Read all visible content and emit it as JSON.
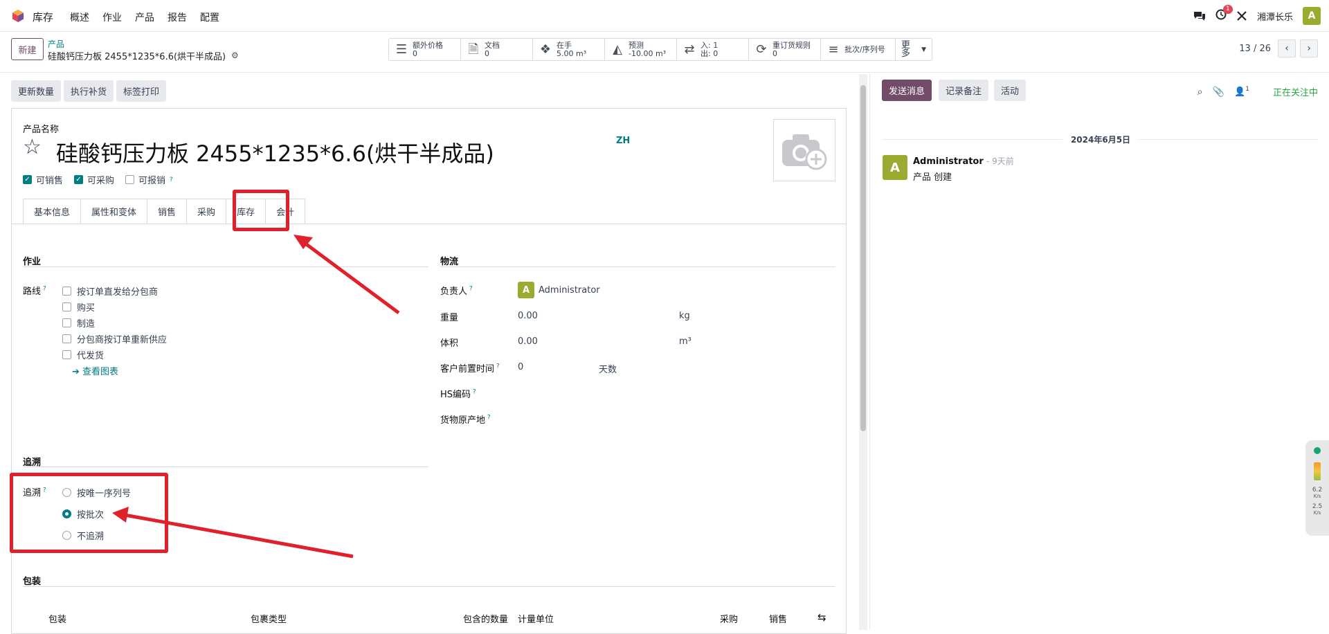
{
  "navbar": {
    "app_name": "库存",
    "menu": [
      "概述",
      "作业",
      "产品",
      "报告",
      "配置"
    ],
    "activity_count": "1",
    "company": "湘潭长乐",
    "user_initial": "A"
  },
  "control_panel": {
    "new_button": "新建",
    "breadcrumb_parent": "产品",
    "breadcrumb_current": "硅酸钙压力板 2455*1235*6.6(烘干半成品)",
    "smart_buttons": [
      {
        "icon": "list-icon",
        "label": "额外价格",
        "value": "0"
      },
      {
        "icon": "document-icon",
        "label": "文档",
        "value": "0"
      },
      {
        "icon": "cubes-icon",
        "label": "在手",
        "value": "5.00 m³"
      },
      {
        "icon": "area-chart-icon",
        "label": "预测",
        "value": "-10.00 m³"
      },
      {
        "icon": "exchange-icon",
        "label": "入:",
        "value": "1",
        "label2": "出:",
        "value2": "0"
      },
      {
        "icon": "refresh-icon",
        "label": "重订货规则",
        "value": "0"
      },
      {
        "icon": "bars-icon",
        "label": "批次/序列号",
        "value": ""
      },
      {
        "icon": "caret-down-icon",
        "label": "更多",
        "value": ""
      }
    ],
    "pager": "13 / 26"
  },
  "action_buttons": [
    "更新数量",
    "执行补货",
    "标签打印"
  ],
  "form": {
    "name_label": "产品名称",
    "product_name": "硅酸钙压力板 2455*1235*6.6(烘干半成品)",
    "lang": "ZH",
    "checkboxes": [
      {
        "label": "可销售",
        "checked": true
      },
      {
        "label": "可采购",
        "checked": true
      },
      {
        "label": "可报销",
        "checked": false
      }
    ],
    "tabs": [
      "基本信息",
      "属性和变体",
      "销售",
      "采购",
      "库存",
      "会计"
    ],
    "active_tab": "库存",
    "operations": {
      "title": "作业",
      "routes_label": "路线",
      "routes": [
        "按订单直发给分包商",
        "购买",
        "制造",
        "分包商按订单重新供应",
        "代发货"
      ],
      "view_diagram": "查看图表"
    },
    "logistics": {
      "title": "物流",
      "responsible_label": "负责人",
      "responsible": "Administrator",
      "weight_label": "重量",
      "weight": "0.00",
      "weight_unit": "kg",
      "volume_label": "体积",
      "volume": "0.00",
      "volume_unit": "m³",
      "lead_label": "客户前置时间",
      "lead": "0",
      "lead_unit": "天数",
      "hs_label": "HS编码",
      "origin_label": "货物原产地"
    },
    "tracking": {
      "title": "追溯",
      "label": "追溯",
      "options": [
        "按唯一序列号",
        "按批次",
        "不追溯"
      ],
      "selected": "按批次"
    },
    "packaging": {
      "title": "包装",
      "columns": [
        "包装",
        "包裹类型",
        "包含的数量",
        "计量单位",
        "采购",
        "销售"
      ]
    }
  },
  "chatter": {
    "send_message": "发送消息",
    "log_note": "记录备注",
    "activity": "活动",
    "follower_count": "1",
    "following": "正在关注中",
    "date": "2024年6月5日",
    "message_author": "Administrator",
    "message_time": "- 9天前",
    "message_body": "产品 创建"
  },
  "net_widget": {
    "up": "6.2",
    "up_unit": "K/s",
    "down": "2.5",
    "down_unit": "K/s"
  },
  "colors": {
    "brand": "#714b67",
    "accent": "#017e84",
    "highlight": "#e0202a",
    "avatar": "#9aab2f"
  }
}
